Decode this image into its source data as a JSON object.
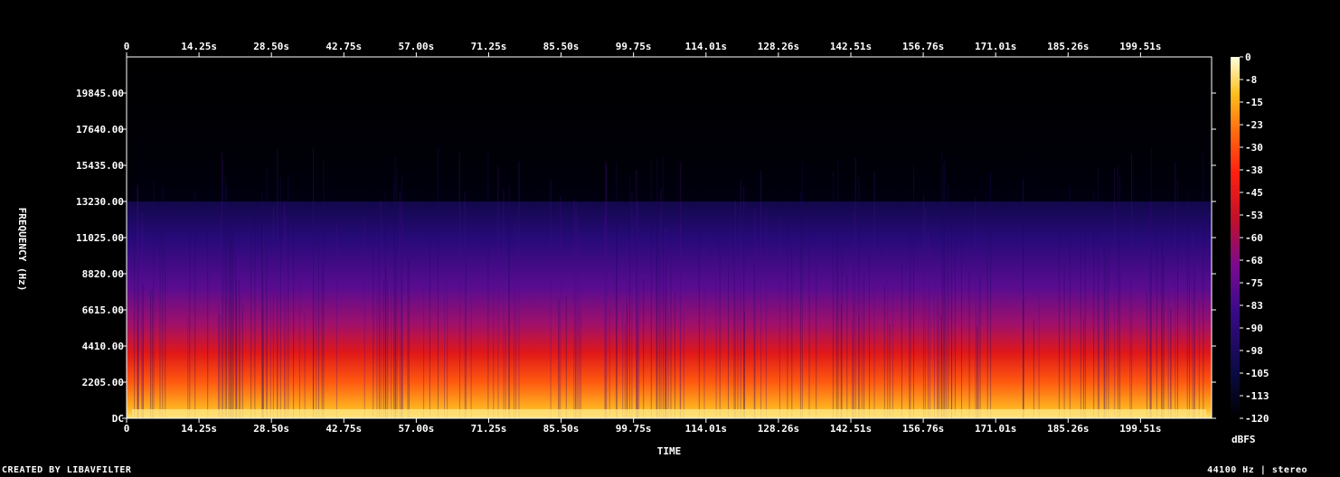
{
  "chart_data": {
    "type": "heatmap",
    "title": "",
    "xlabel": "TIME",
    "ylabel": "FREQUENCY (Hz)",
    "x_ticks": [
      "0",
      "14.25s",
      "28.50s",
      "42.75s",
      "57.00s",
      "71.25s",
      "85.50s",
      "99.75s",
      "114.01s",
      "128.26s",
      "142.51s",
      "156.76s",
      "171.01s",
      "185.26s",
      "199.51s"
    ],
    "x_tick_values": [
      0,
      14.25,
      28.5,
      42.75,
      57.0,
      71.25,
      85.5,
      99.75,
      114.01,
      128.26,
      142.51,
      156.76,
      171.01,
      185.26,
      199.51
    ],
    "xlim": [
      0,
      213.5
    ],
    "y_ticks": [
      "DC",
      "2205.00",
      "4410.00",
      "6615.00",
      "8820.00",
      "11025.00",
      "13230.00",
      "15435.00",
      "17640.00",
      "19845.00"
    ],
    "y_tick_values": [
      0,
      2205,
      4410,
      6615,
      8820,
      11025,
      13230,
      15435,
      17640,
      19845
    ],
    "ylim": [
      0,
      22050
    ],
    "colorbar": {
      "label": "dBFS",
      "ticks": [
        "0",
        "-8",
        "-15",
        "-23",
        "-30",
        "-38",
        "-45",
        "-53",
        "-60",
        "-68",
        "-75",
        "-83",
        "-90",
        "-98",
        "-105",
        "-113",
        "-120"
      ],
      "range": [
        -120,
        0
      ]
    },
    "colors": {
      "background": "#000000",
      "low": "#000020",
      "mid_low": "#3a0a7a",
      "mid": "#c01010",
      "mid_high": "#ff6010",
      "high": "#ffffd0"
    }
  },
  "footer": {
    "left": "CREATED BY LIBAVFILTER",
    "right": "44100 Hz | stereo"
  }
}
